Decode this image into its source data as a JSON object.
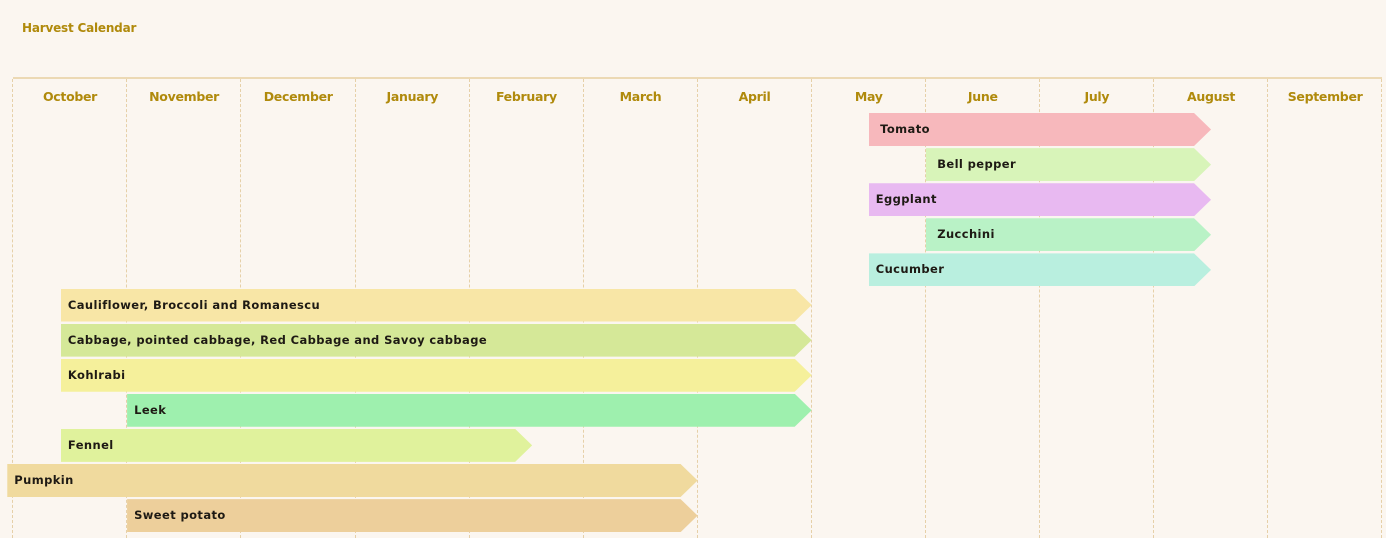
{
  "chart_data": {
    "type": "gantt",
    "title": "Harvest Calendar",
    "months": [
      "October",
      "November",
      "December",
      "January",
      "February",
      "March",
      "April",
      "May",
      "June",
      "July",
      "August",
      "September"
    ],
    "grid": true,
    "bar_style": "arrow",
    "unit_note": "start/end are in months since Oct 1 (0 = Oct 1, 12 = Sep 30)",
    "series": [
      {
        "name": " Tomato",
        "start": 7.5,
        "end": 10.5,
        "color": "#f7b8bc"
      },
      {
        "name": " Bell pepper",
        "start": 8.0,
        "end": 10.5,
        "color": "#d8f4b9"
      },
      {
        "name": "Eggplant",
        "start": 7.5,
        "end": 10.5,
        "color": "#e8b9f1"
      },
      {
        "name": " Zucchini",
        "start": 8.0,
        "end": 10.5,
        "color": "#b9f2c6"
      },
      {
        "name": "Cucumber",
        "start": 7.5,
        "end": 10.5,
        "color": "#b9efdf"
      },
      {
        "name": "Cauliflower, Broccoli and Romanescu",
        "start": 0.42,
        "end": 7.0,
        "color": "#f8e6a6"
      },
      {
        "name": "Cabbage, pointed cabbage, Red Cabbage and Savoy cabbage",
        "start": 0.42,
        "end": 7.0,
        "color": "#d5e898"
      },
      {
        "name": "Kohlrabi",
        "start": 0.42,
        "end": 7.0,
        "color": "#f5f09b"
      },
      {
        "name": "Leek",
        "start": 1.0,
        "end": 7.0,
        "color": "#9ef0ae"
      },
      {
        "name": "Fennel",
        "start": 0.42,
        "end": 4.55,
        "color": "#e0f29c"
      },
      {
        "name": "Pumpkin",
        "start": -0.05,
        "end": 6.0,
        "color": "#f0da9e"
      },
      {
        "name": "Sweet potato",
        "start": 1.0,
        "end": 6.0,
        "color": "#edcf9b"
      }
    ]
  }
}
